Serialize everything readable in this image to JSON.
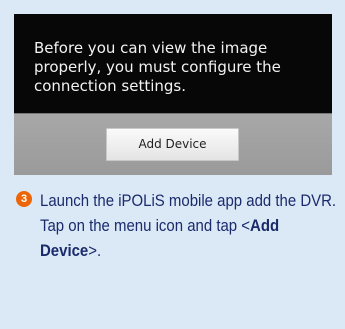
{
  "dialog": {
    "message": "Before you can view the image properly, you must configure the connection settings.",
    "button_label": "Add Device"
  },
  "step": {
    "number": "3",
    "line1": "Launch the iPOLiS mobile app add the DVR.",
    "line2_prefix": "Tap on the menu icon and tap <",
    "line2_bold": "Add Device",
    "line2_suffix": ">."
  },
  "colors": {
    "page_background": "#dbe9f7",
    "step_text": "#1b2a6b",
    "step_badge": "#ec6608",
    "dialog_background": "#070707"
  }
}
